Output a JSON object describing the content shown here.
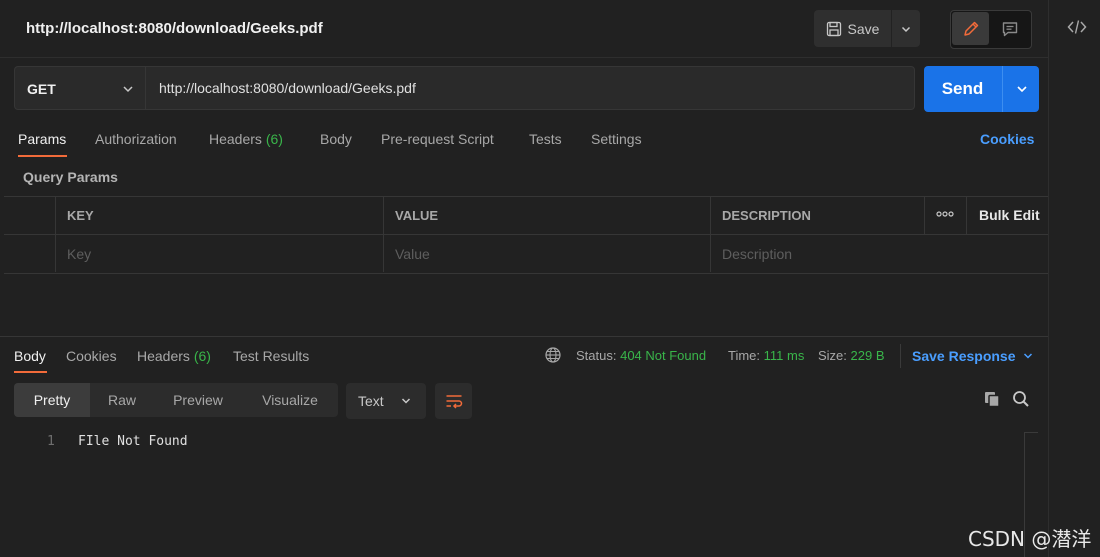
{
  "request": {
    "title": "http://localhost:8080/download/Geeks.pdf",
    "method": "GET",
    "url": "http://localhost:8080/download/Geeks.pdf"
  },
  "toolbar": {
    "save_label": "Save",
    "send_label": "Send"
  },
  "request_tabs": [
    {
      "label": "Params",
      "active": true
    },
    {
      "label": "Authorization"
    },
    {
      "label": "Headers",
      "count": "(6)"
    },
    {
      "label": "Body"
    },
    {
      "label": "Pre-request Script"
    },
    {
      "label": "Tests"
    },
    {
      "label": "Settings"
    }
  ],
  "cookies_link": "Cookies",
  "query_params": {
    "title": "Query Params",
    "headers": [
      "KEY",
      "VALUE",
      "DESCRIPTION"
    ],
    "bulk_edit": "Bulk Edit",
    "placeholders": {
      "key": "Key",
      "value": "Value",
      "description": "Description"
    }
  },
  "response": {
    "tabs": [
      {
        "label": "Body",
        "active": true
      },
      {
        "label": "Cookies"
      },
      {
        "label": "Headers",
        "count": "(6)"
      },
      {
        "label": "Test Results"
      }
    ],
    "status_label": "Status:",
    "status_value": "404 Not Found",
    "time_label": "Time:",
    "time_value": "111 ms",
    "size_label": "Size:",
    "size_value": "229 B",
    "save_response": "Save Response",
    "view_modes": [
      "Pretty",
      "Raw",
      "Preview",
      "Visualize"
    ],
    "format": "Text",
    "lines": [
      {
        "n": "1",
        "text": "FIle Not Found"
      }
    ]
  },
  "watermark": "CSDN @潜洋",
  "colors": {
    "accent": "#1a73e8",
    "tab_active": "#f26b3a",
    "success": "#39b54a",
    "link": "#4a9eff"
  },
  "icons": [
    "save-icon",
    "chevron-down-icon",
    "pencil-icon",
    "comment-icon",
    "code-icon",
    "more-dots-icon",
    "globe-icon",
    "wrap-lines-icon",
    "copy-icon",
    "search-icon"
  ]
}
